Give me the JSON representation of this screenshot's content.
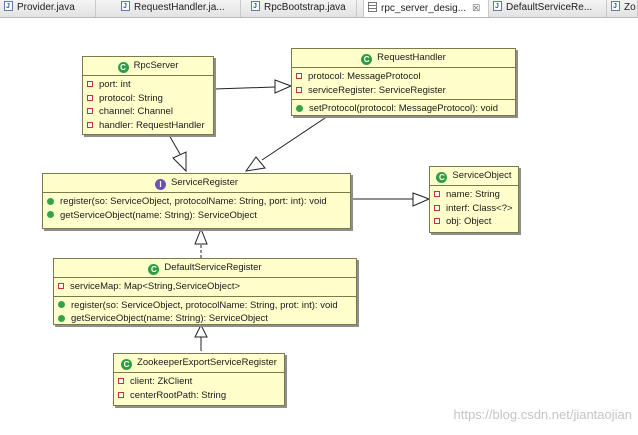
{
  "tabs": [
    {
      "label": "Provider.java",
      "icon": "java-file-icon"
    },
    {
      "label": "RequestHandler.ja...",
      "icon": "java-file-icon"
    },
    {
      "label": "RpcBootstrap.java",
      "icon": "java-file-icon"
    },
    {
      "label": "rpc_server_desig...",
      "icon": "class-diagram-icon",
      "close": "☒",
      "active": true
    },
    {
      "label": "DefaultServiceRe...",
      "icon": "java-file-icon"
    },
    {
      "label": "Zo",
      "icon": "java-file-icon"
    }
  ],
  "classes": {
    "rpc_server": {
      "name": "RpcServer",
      "fields": [
        "port: int",
        "protocol: String",
        "channel: Channel",
        "handler: RequestHandler"
      ],
      "methods": []
    },
    "request_handler": {
      "name": "RequestHandler",
      "fields": [
        "protocol: MessageProtocol",
        "serviceRegister: ServiceRegister"
      ],
      "methods": [
        "setProtocol(protocol: MessageProtocol): void"
      ]
    },
    "service_register": {
      "name": "ServiceRegister",
      "stereotype": "interface",
      "fields": [],
      "methods": [
        "register(so: ServiceObject, protocolName: String, port: int): void",
        "getServiceObject(name: String): ServiceObject"
      ]
    },
    "service_object": {
      "name": "ServiceObject",
      "fields": [
        "name: String",
        "interf: Class<?>",
        "obj: Object"
      ],
      "methods": []
    },
    "default_service_register": {
      "name": "DefaultServiceRegister",
      "fields": [
        "serviceMap: Map<String,ServiceObject>"
      ],
      "methods": [
        "register(so: ServiceObject, protocolName: String, prot: int): void",
        "getServiceObject(name: String): ServiceObject"
      ]
    },
    "zookeeper_export_service_register": {
      "name": "ZookeeperExportServiceRegister",
      "fields": [
        "client: ZkClient",
        "centerRootPath: String"
      ],
      "methods": []
    }
  },
  "relations": [
    {
      "from": "RpcServer",
      "to": "RequestHandler",
      "kind": "association"
    },
    {
      "from": "RpcServer",
      "to": "ServiceRegister",
      "kind": "association"
    },
    {
      "from": "RequestHandler",
      "to": "ServiceRegister",
      "kind": "association"
    },
    {
      "from": "ServiceRegister",
      "to": "ServiceObject",
      "kind": "association"
    },
    {
      "from": "DefaultServiceRegister",
      "to": "ServiceRegister",
      "kind": "realization"
    },
    {
      "from": "ZookeeperExportServiceRegister",
      "to": "DefaultServiceRegister",
      "kind": "generalization"
    }
  ],
  "colors": {
    "class_fill": "#ffffcc",
    "class_border": "#7a7a4a",
    "class_icon": "#2f9e41",
    "interface_icon": "#6c53b3",
    "field_icon": "#c0392b",
    "method_icon": "#35a247"
  },
  "watermark": "https://blog.csdn.net/jiantaojian"
}
